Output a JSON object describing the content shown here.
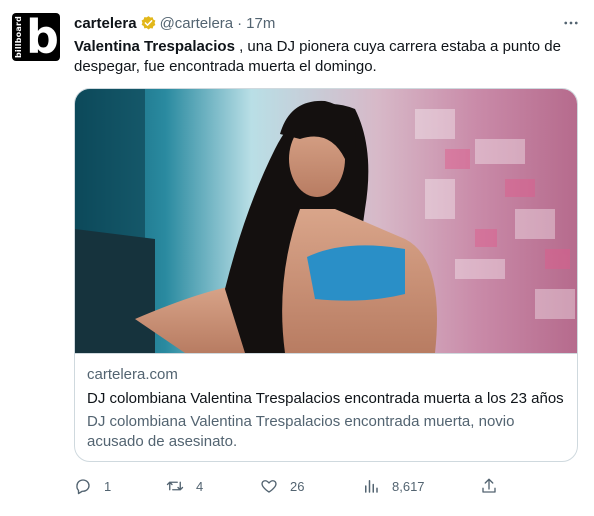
{
  "account": {
    "display_name": "cartelera",
    "handle": "@cartelera",
    "separator": "·",
    "time": "17m",
    "avatar_text": "billboard",
    "avatar_letter": "b"
  },
  "tweet": {
    "bold_name": "Valentina Trespalacios",
    "text_rest": " , una DJ pionera cuya carrera estaba a punto de despegar, fue encontrada muerta el domingo."
  },
  "card": {
    "domain": "cartelera.com",
    "title": "DJ colombiana Valentina Trespalacios encontrada muerta a los 23 años",
    "description": "DJ colombiana Valentina Trespalacios encontrada muerta, novio acusado de asesinato."
  },
  "actions": {
    "replies": "1",
    "retweets": "4",
    "likes": "26",
    "views": "8,617"
  },
  "colors": {
    "verified_badge": "#e2b719",
    "secondary_text": "#536471"
  },
  "icons": [
    "more-icon",
    "verified-badge-icon",
    "reply-icon",
    "retweet-icon",
    "like-icon",
    "views-icon",
    "share-icon"
  ]
}
